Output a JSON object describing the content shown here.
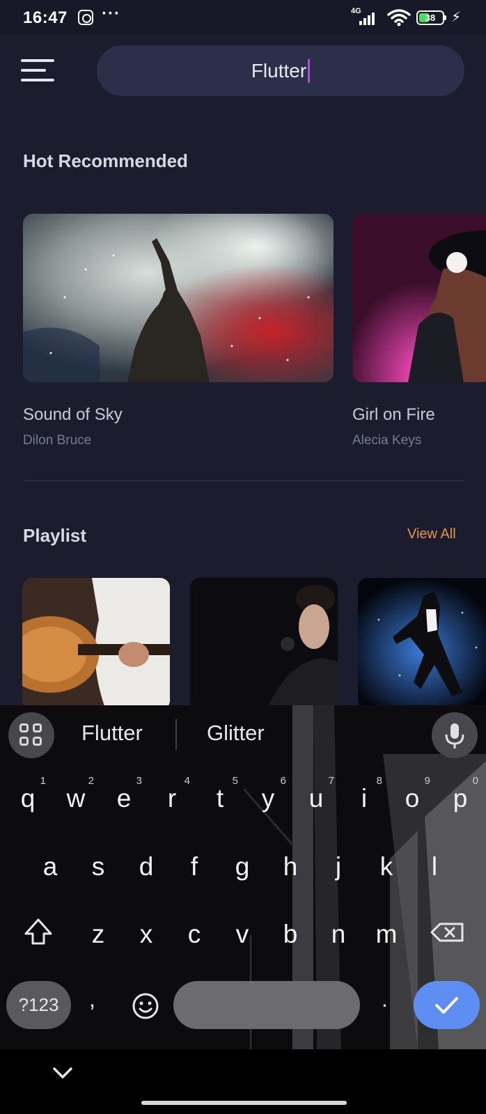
{
  "status_bar": {
    "time": "16:47",
    "network": "4G",
    "battery": "38",
    "icons": [
      "instagram-icon",
      "more-dots-icon",
      "signal-icon",
      "wifi-icon",
      "battery-icon",
      "charging-icon"
    ]
  },
  "header": {
    "menu_icon": "hamburger-menu-icon",
    "search_value": "Flutter"
  },
  "hot": {
    "title": "Hot Recommended",
    "items": [
      {
        "title": "Sound of Sky",
        "artist": "Dilon Bruce"
      },
      {
        "title": "Girl on Fire",
        "artist": "Alecia Keys"
      }
    ]
  },
  "playlist": {
    "title": "Playlist",
    "view_all": "View All"
  },
  "keyboard": {
    "suggestions": [
      "Flutter",
      "Glitter"
    ],
    "row1": [
      {
        "k": "q",
        "n": "1"
      },
      {
        "k": "w",
        "n": "2"
      },
      {
        "k": "e",
        "n": "3"
      },
      {
        "k": "r",
        "n": "4"
      },
      {
        "k": "t",
        "n": "5"
      },
      {
        "k": "y",
        "n": "6"
      },
      {
        "k": "u",
        "n": "7"
      },
      {
        "k": "i",
        "n": "8"
      },
      {
        "k": "o",
        "n": "9"
      },
      {
        "k": "p",
        "n": "0"
      }
    ],
    "row2": [
      "a",
      "s",
      "d",
      "f",
      "g",
      "h",
      "j",
      "k",
      "l"
    ],
    "row3": [
      "z",
      "x",
      "c",
      "v",
      "b",
      "n",
      "m"
    ],
    "symbols_label": "?123",
    "comma": ",",
    "period": "."
  },
  "colors": {
    "background": "#1b1d2e",
    "search_bg": "#2b2f4a",
    "accent": "#e2964a",
    "caret": "#b14cd6",
    "enter_key": "#5f8ef2"
  }
}
